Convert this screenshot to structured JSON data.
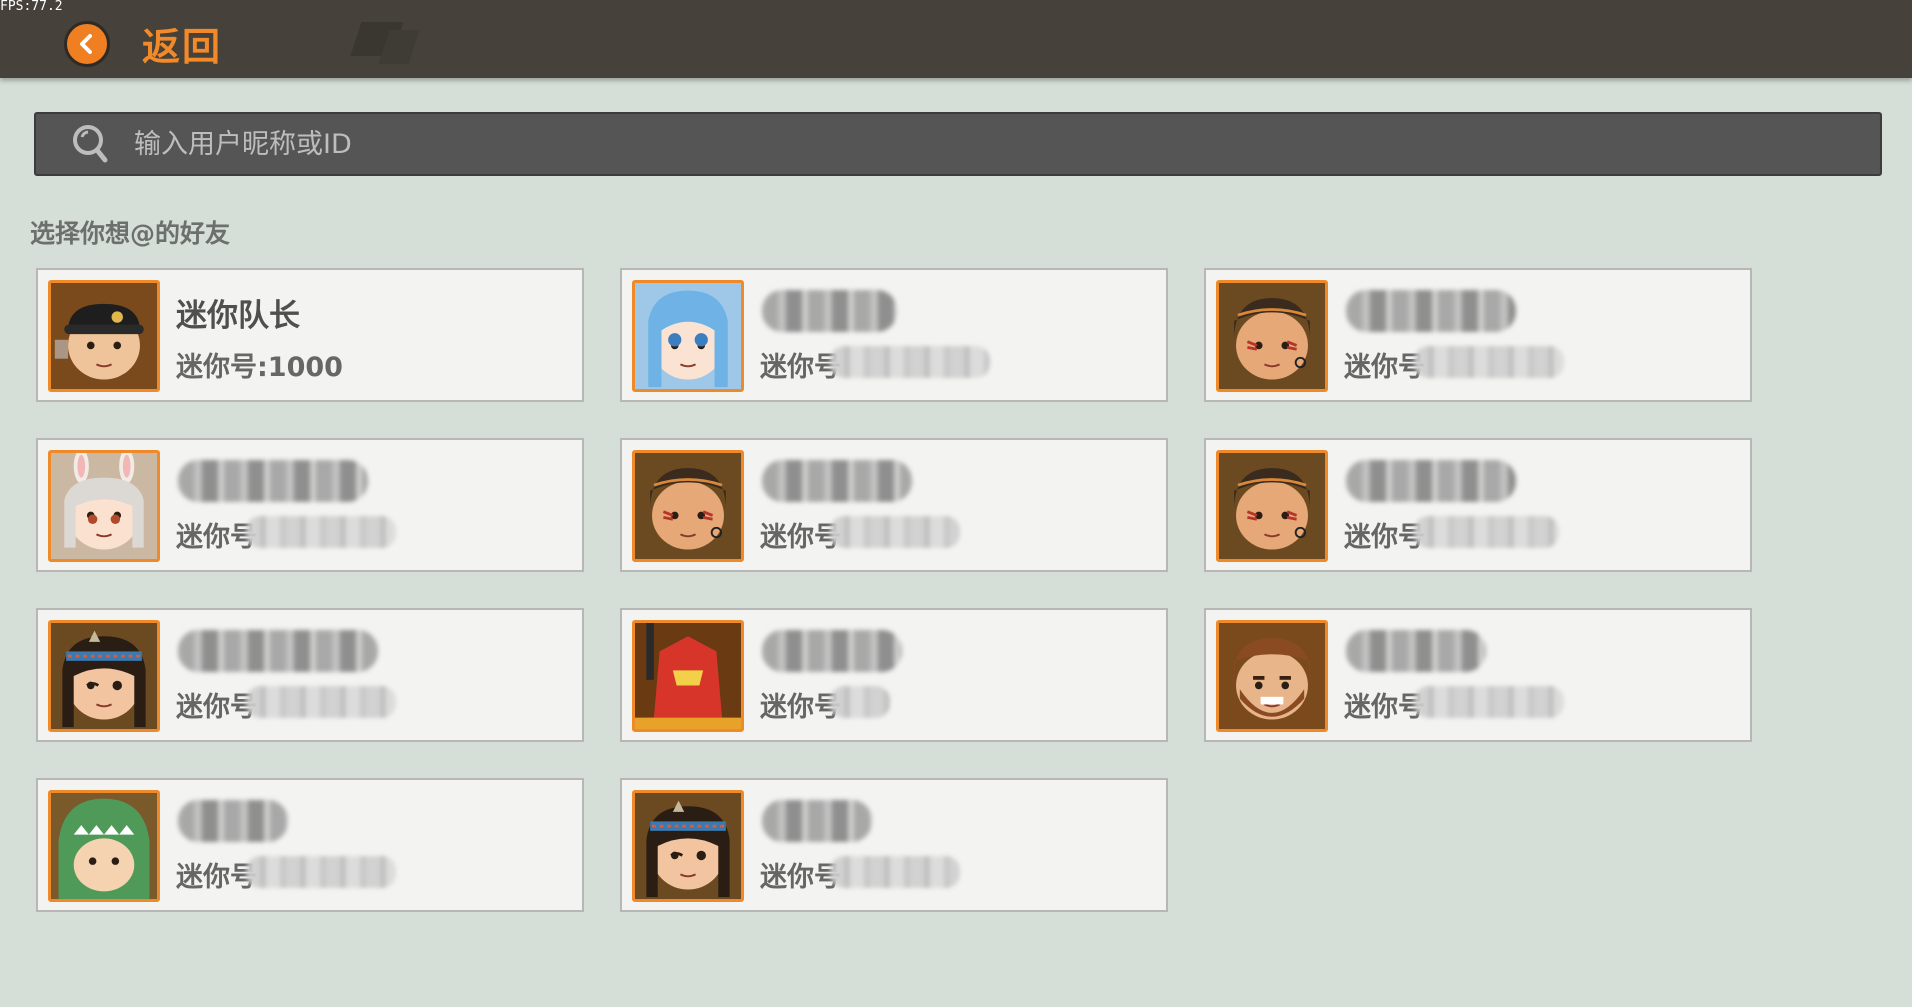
{
  "fps": "FPS:77.2",
  "header": {
    "back_label": "返回"
  },
  "search": {
    "placeholder": "输入用户昵称或ID"
  },
  "section_title": "选择你想@的好友",
  "friends": [
    {
      "name": "迷你队长",
      "id_prefix": "迷你号",
      "id_value": ":1000",
      "avatar": "captain-avatar",
      "colors": {
        "bg": "#7a4a1c",
        "skin": "#f0c49a",
        "hat": "#1e1e1e"
      }
    },
    {
      "id_prefix": "迷你号",
      "avatar": "ice-girl-avatar",
      "colors": {
        "bg": "#9fc8e8",
        "skin": "#fbe3d4",
        "hat": "#6fb3e6"
      }
    },
    {
      "id_prefix": "迷你号",
      "avatar": "tribal-girl-avatar",
      "colors": {
        "bg": "#6b4a22",
        "skin": "#e7a878",
        "hat": "#3b2a1e"
      }
    },
    {
      "id_prefix": "迷你号",
      "avatar": "bunny-girl-avatar",
      "colors": {
        "bg": "#cbb8a2",
        "skin": "#fbe2d0",
        "hat": "#dcd8d3"
      }
    },
    {
      "id_prefix": "迷你号",
      "avatar": "tribal-girl-avatar",
      "colors": {
        "bg": "#6b4a22",
        "skin": "#e7a878",
        "hat": "#3b2a1e"
      }
    },
    {
      "id_prefix": "迷你号",
      "avatar": "tribal-girl-avatar",
      "colors": {
        "bg": "#6b4a22",
        "skin": "#e7a878",
        "hat": "#3b2a1e"
      }
    },
    {
      "id_prefix": "迷你号",
      "avatar": "headband-girl-avatar",
      "colors": {
        "bg": "#6b4a22",
        "skin": "#f2c5a0",
        "hat": "#2a1d14"
      }
    },
    {
      "id_prefix": "迷你号",
      "avatar": "red-mech-avatar",
      "colors": {
        "bg": "#6a3a12",
        "skin": "#d7352a",
        "hat": "#e8a22a"
      }
    },
    {
      "id_prefix": "迷你号",
      "avatar": "bearded-man-avatar",
      "colors": {
        "bg": "#7a4a1c",
        "skin": "#e8b48a",
        "hat": "#8a4a22"
      }
    },
    {
      "id_prefix": "迷你号",
      "avatar": "dino-hood-avatar",
      "colors": {
        "bg": "#7a5a2a",
        "skin": "#f5d2b0",
        "hat": "#4f9a58"
      }
    },
    {
      "id_prefix": "迷你号",
      "avatar": "headband-girl-avatar",
      "colors": {
        "bg": "#6b4a22",
        "skin": "#f2c5a0",
        "hat": "#2a1d14"
      }
    }
  ],
  "colors": {
    "accent": "#f07f22",
    "topbar": "#46413a",
    "background": "#d5ded7"
  }
}
